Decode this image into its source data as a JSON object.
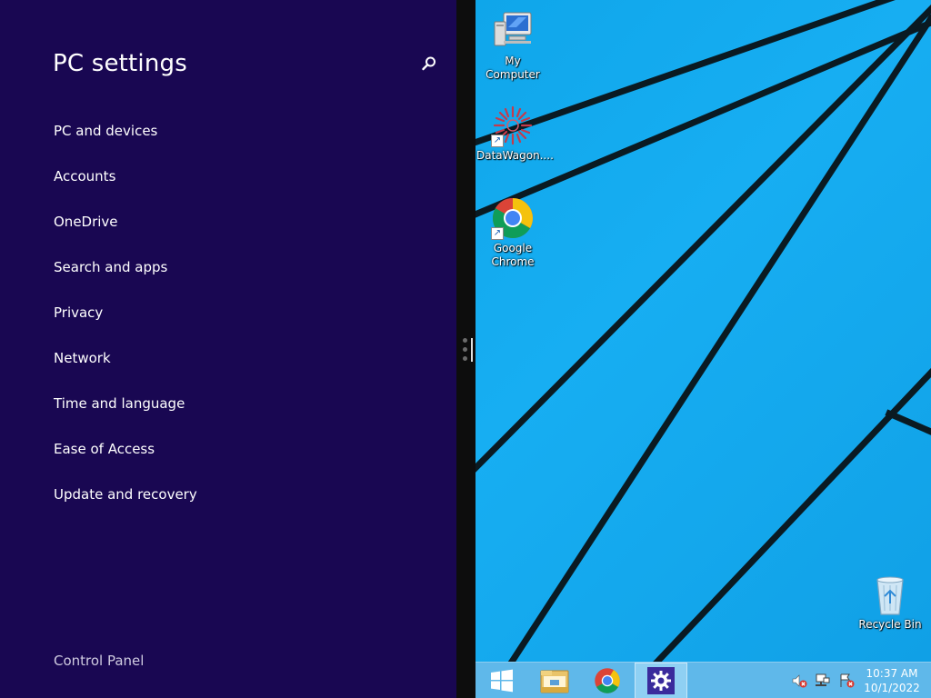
{
  "settings": {
    "title": "PC settings",
    "nav_items": [
      {
        "label": "PC and devices"
      },
      {
        "label": "Accounts"
      },
      {
        "label": "OneDrive"
      },
      {
        "label": "Search and apps"
      },
      {
        "label": "Privacy"
      },
      {
        "label": "Network"
      },
      {
        "label": "Time and language"
      },
      {
        "label": "Ease of Access"
      },
      {
        "label": "Update and recovery"
      }
    ],
    "control_panel_label": "Control Panel",
    "search_icon": "search-icon"
  },
  "desktop": {
    "icons": [
      {
        "label": "My Computer",
        "icon": "computer-icon"
      },
      {
        "label": "DataWagon....",
        "icon": "datawagon-icon"
      },
      {
        "label": "Google Chrome",
        "icon": "chrome-icon"
      },
      {
        "label": "Recycle Bin",
        "icon": "recycle-bin-icon"
      }
    ]
  },
  "taskbar": {
    "buttons": [
      {
        "name": "start",
        "icon": "windows-logo-icon"
      },
      {
        "name": "file-explorer",
        "icon": "folder-icon"
      },
      {
        "name": "chrome",
        "icon": "chrome-icon"
      },
      {
        "name": "pc-settings",
        "icon": "gear-icon",
        "active": true
      }
    ],
    "tray_icons": [
      "speaker-muted-icon",
      "network-icon",
      "action-center-icon"
    ],
    "clock": {
      "time": "10:37 AM",
      "date": "10/1/2022"
    }
  },
  "colors": {
    "settings_bg": "#190752",
    "desktop_bg": "#17aef2",
    "taskbar_bg": "#5fb8ea"
  }
}
